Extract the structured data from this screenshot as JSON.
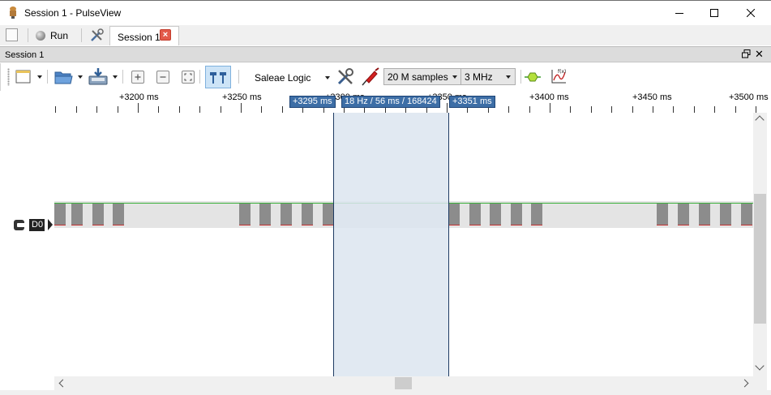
{
  "window": {
    "title": "Session 1 - PulseView",
    "icon": "pulseview-icon",
    "controls": [
      "minimize-icon",
      "maximize-icon",
      "close-icon"
    ]
  },
  "top_bar": {
    "run_label": "Run",
    "tab_label": "Session 1"
  },
  "dock": {
    "title": "Session 1"
  },
  "toolbar": {
    "device": "Saleae Logic",
    "samples": "20 M samples",
    "samplerate": "3 MHz",
    "icons": [
      "new-view-icon",
      "open-icon",
      "save-icon",
      "zoom-in-icon",
      "zoom-out-icon",
      "zoom-fit-icon",
      "cursor-icon",
      "device-config-icon",
      "probe-icon",
      "decoder-icon",
      "math-icon"
    ]
  },
  "ruler": {
    "ticks": [
      "+3200 ms",
      "+3250 ms",
      "+3300 ms",
      "+3350 ms",
      "+3400 ms",
      "+3450 ms",
      "+3500 ms"
    ],
    "cursor_left": "+3295 ms",
    "cursor_right": "+3351 ms",
    "cursor_span": "18 Hz / 56 ms / 168424"
  },
  "channel": {
    "label": "D0",
    "color": "#3bb13b"
  },
  "colors": {
    "selection": "#dce5f0",
    "pulse": "#8c8c8c",
    "flag": "#3d6ea6"
  }
}
